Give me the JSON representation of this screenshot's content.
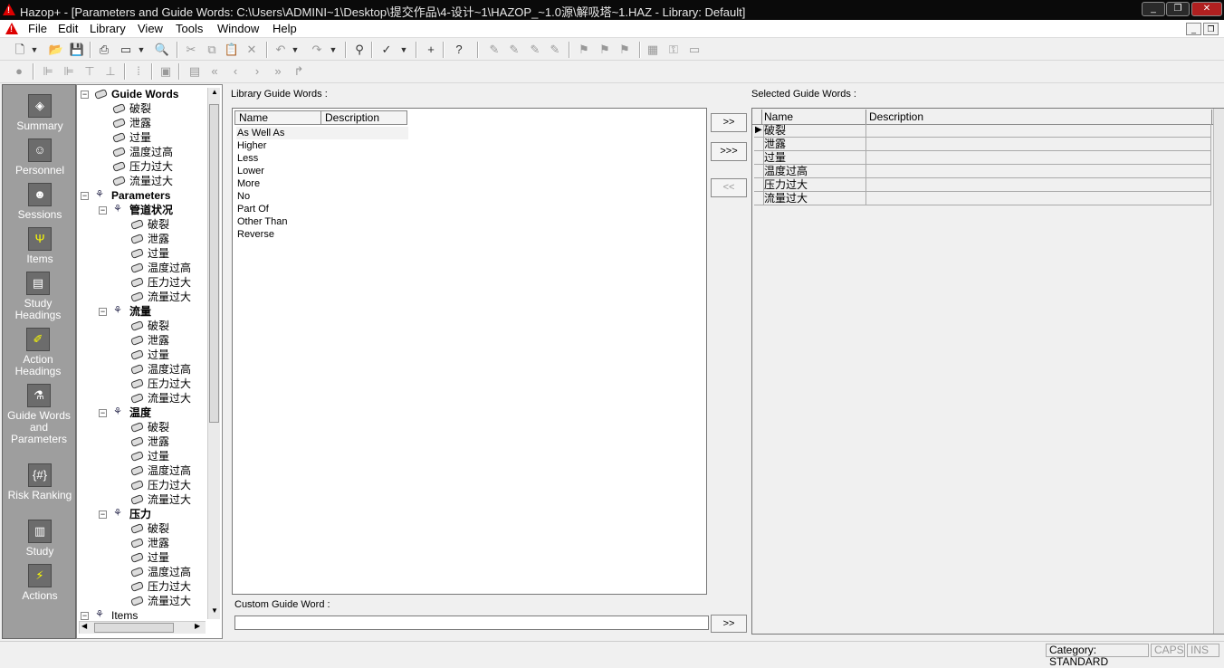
{
  "window": {
    "title": "Hazop+ - [Parameters and Guide Words: C:\\Users\\ADMINI~1\\Desktop\\提交作品\\4-设计~1\\HAZOP_~1.0源\\解吸塔~1.HAZ - Library: Default]"
  },
  "menu": [
    "File",
    "Edit",
    "Library",
    "View",
    "Tools",
    "Window",
    "Help"
  ],
  "sidebar": [
    {
      "label": "Summary",
      "icon": "summary-icon"
    },
    {
      "label": "Personnel",
      "icon": "personnel-icon"
    },
    {
      "label": "Sessions",
      "icon": "sessions-icon"
    },
    {
      "label": "Items",
      "icon": "items-icon"
    },
    {
      "label": "Study Headings",
      "icon": "study-headings-icon"
    },
    {
      "label": "Action Headings",
      "icon": "action-headings-icon"
    },
    {
      "label": "Guide Words and Parameters",
      "icon": "guide-words-icon"
    },
    {
      "label": "Risk Ranking",
      "icon": "risk-ranking-icon"
    },
    {
      "label": "Study",
      "icon": "study-icon"
    },
    {
      "label": "Actions",
      "icon": "actions-icon"
    }
  ],
  "tree": {
    "guide_words_label": "Guide Words",
    "guide_words": [
      "破裂",
      "泄露",
      "过量",
      "温度过高",
      "压力过大",
      "流量过大"
    ],
    "parameters_label": "Parameters",
    "parameters": [
      {
        "name": "管道状况",
        "children": [
          "破裂",
          "泄露",
          "过量",
          "温度过高",
          "压力过大",
          "流量过大"
        ]
      },
      {
        "name": "流量",
        "children": [
          "破裂",
          "泄露",
          "过量",
          "温度过高",
          "压力过大",
          "流量过大"
        ]
      },
      {
        "name": "温度",
        "children": [
          "破裂",
          "泄露",
          "过量",
          "温度过高",
          "压力过大",
          "流量过大"
        ]
      },
      {
        "name": "压力",
        "children": [
          "破裂",
          "泄露",
          "过量",
          "温度过高",
          "压力过大",
          "流量过大"
        ]
      }
    ],
    "items_label": "Items"
  },
  "library": {
    "label": "Library Guide Words :",
    "col_name": "Name",
    "col_desc": "Description",
    "rows": [
      "As Well As",
      "Higher",
      "Less",
      "Lower",
      "More",
      "No",
      "Part Of",
      "Other Than",
      "Reverse"
    ]
  },
  "buttons": {
    "add": ">>",
    "add_all": ">>>",
    "remove": "<<",
    "add_custom": ">>"
  },
  "selected": {
    "label": "Selected Guide Words :",
    "col_name": "Name",
    "col_desc": "Description",
    "rows": [
      "破裂",
      "泄露",
      "过量",
      "温度过高",
      "压力过大",
      "流量过大"
    ]
  },
  "custom": {
    "label": "Custom Guide Word :",
    "value": ""
  },
  "status": {
    "category": "Category: STANDARD",
    "caps": "CAPS",
    "ins": "INS"
  }
}
